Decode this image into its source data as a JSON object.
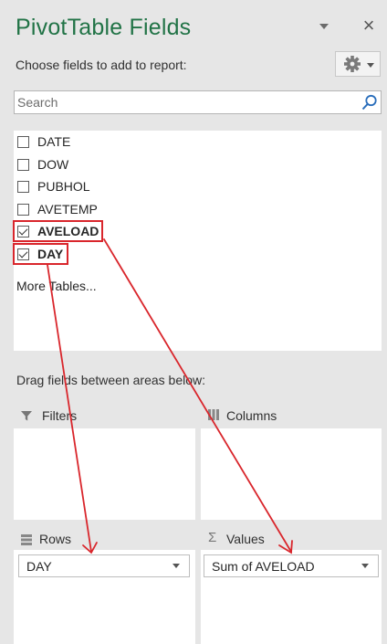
{
  "panel": {
    "title": "PivotTable Fields",
    "subtitle": "Choose fields to add to report:",
    "close_glyph": "×"
  },
  "search": {
    "placeholder": "Search"
  },
  "fields": [
    {
      "label": "DATE",
      "checked": false
    },
    {
      "label": "DOW",
      "checked": false
    },
    {
      "label": "PUBHOL",
      "checked": false
    },
    {
      "label": "AVETEMP",
      "checked": false
    },
    {
      "label": "AVELOAD",
      "checked": true
    },
    {
      "label": "DAY",
      "checked": true
    }
  ],
  "more_tables": "More Tables...",
  "drag_label": "Drag fields between areas below:",
  "areas": {
    "filters": {
      "label": "Filters"
    },
    "columns": {
      "label": "Columns"
    },
    "rows": {
      "label": "Rows",
      "items": [
        "DAY"
      ]
    },
    "values": {
      "label": "Values",
      "items": [
        "Sum of AVELOAD"
      ]
    }
  },
  "colors": {
    "title_green": "#217346",
    "annotation_red": "#d9262c"
  },
  "icons": [
    "caret-down-icon",
    "close-icon",
    "gear-icon",
    "search-icon",
    "filter-icon",
    "columns-icon",
    "rows-icon",
    "sigma-icon"
  ]
}
